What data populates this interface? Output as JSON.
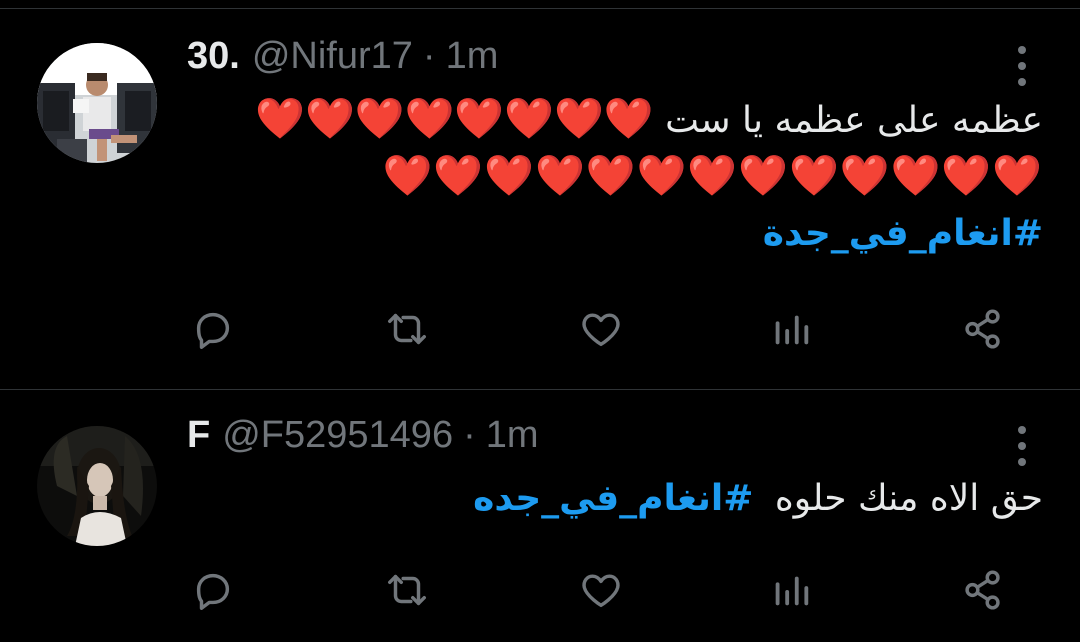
{
  "tweets": [
    {
      "display_name": "30.",
      "handle": "@Nifur17",
      "separator": "·",
      "time": "1m",
      "text_line1": "عظمه على عظمه يا ست",
      "hearts_line1": "❤️❤️❤️❤️❤️❤️❤️❤️",
      "hearts_line2": "❤️❤️❤️❤️❤️❤️❤️❤️❤️❤️❤️❤️❤️",
      "hashtag": "#انغام_في_جدة"
    },
    {
      "display_name": "F",
      "handle": "@F52951496",
      "separator": "·",
      "time": "1m",
      "text": "حق الاه منك حلوه",
      "hashtag_prefix": "#",
      "hashtag": "انغام_في_جده"
    }
  ],
  "icons": {
    "reply": "reply-icon",
    "retweet": "retweet-icon",
    "like": "heart-icon",
    "views": "analytics-icon",
    "share": "share-icon",
    "more": "more-icon"
  },
  "colors": {
    "background": "#000000",
    "text": "#e7e9ea",
    "secondary": "#71767b",
    "link": "#1d9bf0",
    "divider": "#2f3336",
    "heart_emoji": "#ea3140"
  }
}
